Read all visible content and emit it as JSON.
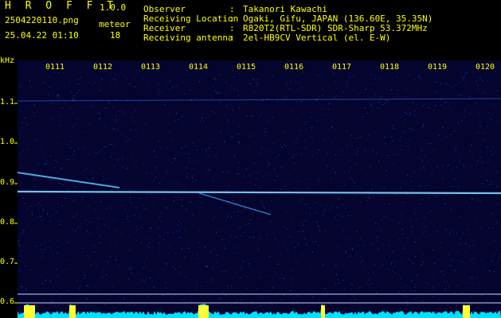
{
  "header": {
    "app_title": "H R O F F T",
    "app_version": "1.0.0",
    "filename": "2504220110.png",
    "detection_label": "meteor",
    "datetime": "25.04.22 01:10",
    "detection_count": "18",
    "info": [
      {
        "label": "Observer",
        "value": "Takanori Kawachi"
      },
      {
        "label": "Receiving Location",
        "value": "Ogaki, Gifu, JAPAN (136.60E, 35.35N)"
      },
      {
        "label": "Receiver",
        "value": "R820T2(RTL-SDR) SDR-Sharp 53.372MHz"
      },
      {
        "label": "Receiving antenna",
        "value": "2el-HB9CV Vertical (el. E-W)"
      }
    ]
  },
  "spectrogram": {
    "unit_label": "kHz",
    "y_ticks": [
      "1.1",
      "1.0",
      "0.9",
      "0.8",
      "0.7",
      "0.6"
    ],
    "x_ticks": [
      "0111",
      "0112",
      "0113",
      "0114",
      "0115",
      "0116",
      "0117",
      "0118",
      "0119",
      "0120"
    ],
    "colors": {
      "background": "#04042e",
      "signal": "#7fd8ff",
      "text": "#ffff00",
      "level": "#00e0ff"
    }
  }
}
